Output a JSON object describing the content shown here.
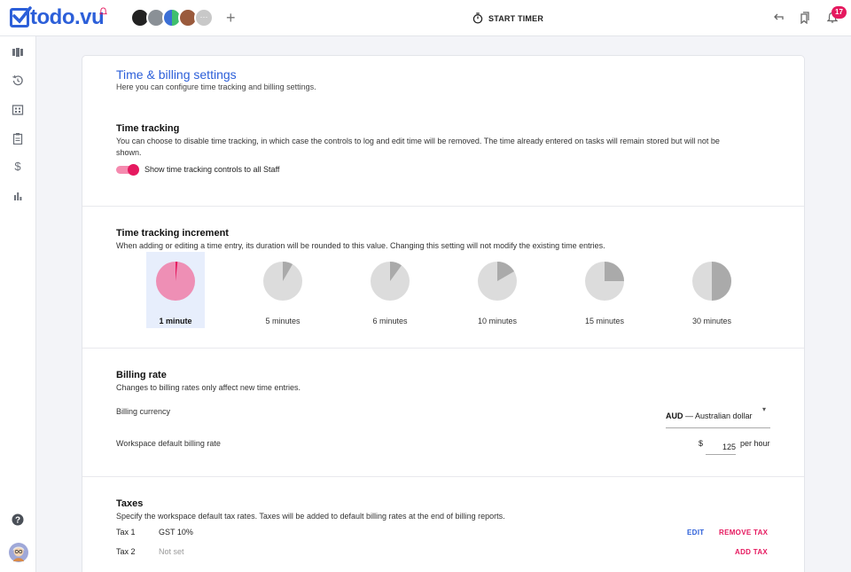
{
  "app": {
    "logo_text": "todo.vu"
  },
  "header": {
    "timer_label": "START TIMER",
    "notification_count": "17",
    "avatar_overflow": "···"
  },
  "page": {
    "title": "Time & billing settings",
    "subtitle": "Here you can configure time tracking and billing settings."
  },
  "time_tracking": {
    "heading": "Time tracking",
    "description_line1": "You can choose to disable time tracking, in which case the controls to log and edit time will be removed. The time already entered on tasks will remain stored but will not be",
    "description_line2": "shown.",
    "toggle_label": "Show time tracking controls to all Staff",
    "toggle_on": true
  },
  "increment": {
    "heading": "Time tracking increment",
    "description": "When adding or editing a time entry, its duration will be rounded to this value. Changing this setting will not modify the existing time entries.",
    "options": [
      {
        "label": "1 minute",
        "fraction": 0.0167,
        "selected": true
      },
      {
        "label": "5 minutes",
        "fraction": 0.0833,
        "selected": false
      },
      {
        "label": "6 minutes",
        "fraction": 0.1,
        "selected": false
      },
      {
        "label": "10 minutes",
        "fraction": 0.1667,
        "selected": false
      },
      {
        "label": "15 minutes",
        "fraction": 0.25,
        "selected": false
      },
      {
        "label": "30 minutes",
        "fraction": 0.5,
        "selected": false
      }
    ]
  },
  "billing": {
    "heading": "Billing rate",
    "description": "Changes to billing rates only affect new time entries.",
    "currency_label": "Billing currency",
    "currency_code": "AUD",
    "currency_name": "— Australian dollar",
    "rate_label": "Workspace default billing rate",
    "rate_symbol": "$",
    "rate_value": "125",
    "rate_unit": "per hour"
  },
  "taxes": {
    "heading": "Taxes",
    "description": "Specify the workspace default tax rates. Taxes will be added to default billing rates at the end of billing reports.",
    "tax1_label": "Tax 1",
    "tax1_value": "GST 10%",
    "tax2_label": "Tax 2",
    "tax2_value": "Not set",
    "edit_label": "EDIT",
    "remove_label": "REMOVE TAX",
    "add_label": "ADD TAX"
  },
  "colors": {
    "accent_blue": "#2c5fd9",
    "accent_pink": "#e5195f",
    "pie_selected": "#ee8fb5",
    "pie_unselected": "#dcdcdc",
    "pie_slice": "#aaaaaa"
  }
}
